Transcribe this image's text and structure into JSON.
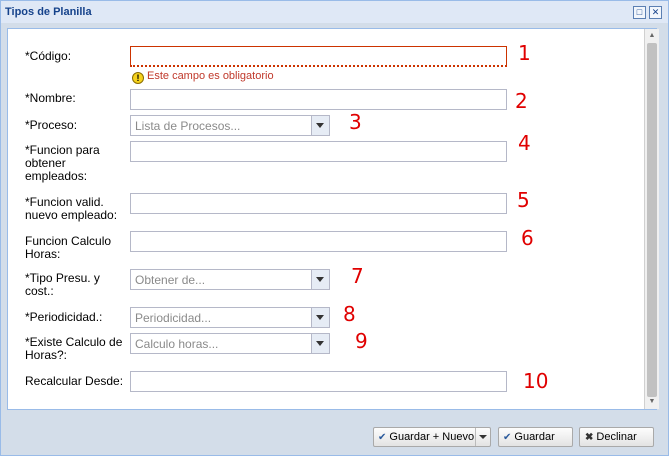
{
  "window": {
    "title": "Tipos de Planilla"
  },
  "fields": {
    "codigo_label": "*Código:",
    "codigo_error": "Este campo es obligatorio",
    "nombre_label": "*Nombre:",
    "proceso_label": "*Proceso:",
    "proceso_placeholder": "Lista de Procesos...",
    "funcion_empleados_label": "*Funcion para obtener empleados:",
    "funcion_valid_label": "*Funcion valid. nuevo empleado:",
    "funcion_horas_label": "Funcion Calculo Horas:",
    "tipo_presu_label": "*Tipo Presu. y cost.:",
    "tipo_presu_placeholder": "Obtener de...",
    "periodicidad_label": "*Periodicidad.:",
    "periodicidad_placeholder": "Periodicidad...",
    "existe_calculo_label": "*Existe Calculo de Horas?:",
    "existe_calculo_placeholder": "Calculo horas...",
    "recalcular_label": "Recalcular Desde:"
  },
  "annotations": [
    "1",
    "2",
    "3",
    "4",
    "5",
    "6",
    "7",
    "8",
    "9",
    "10"
  ],
  "buttons": {
    "guardar_nuevo": "Guardar + Nuevo",
    "guardar": "Guardar",
    "declinar": "Declinar"
  },
  "colors": {
    "annotation": "#e00000",
    "error_text": "#c0392b",
    "title": "#15428b"
  }
}
